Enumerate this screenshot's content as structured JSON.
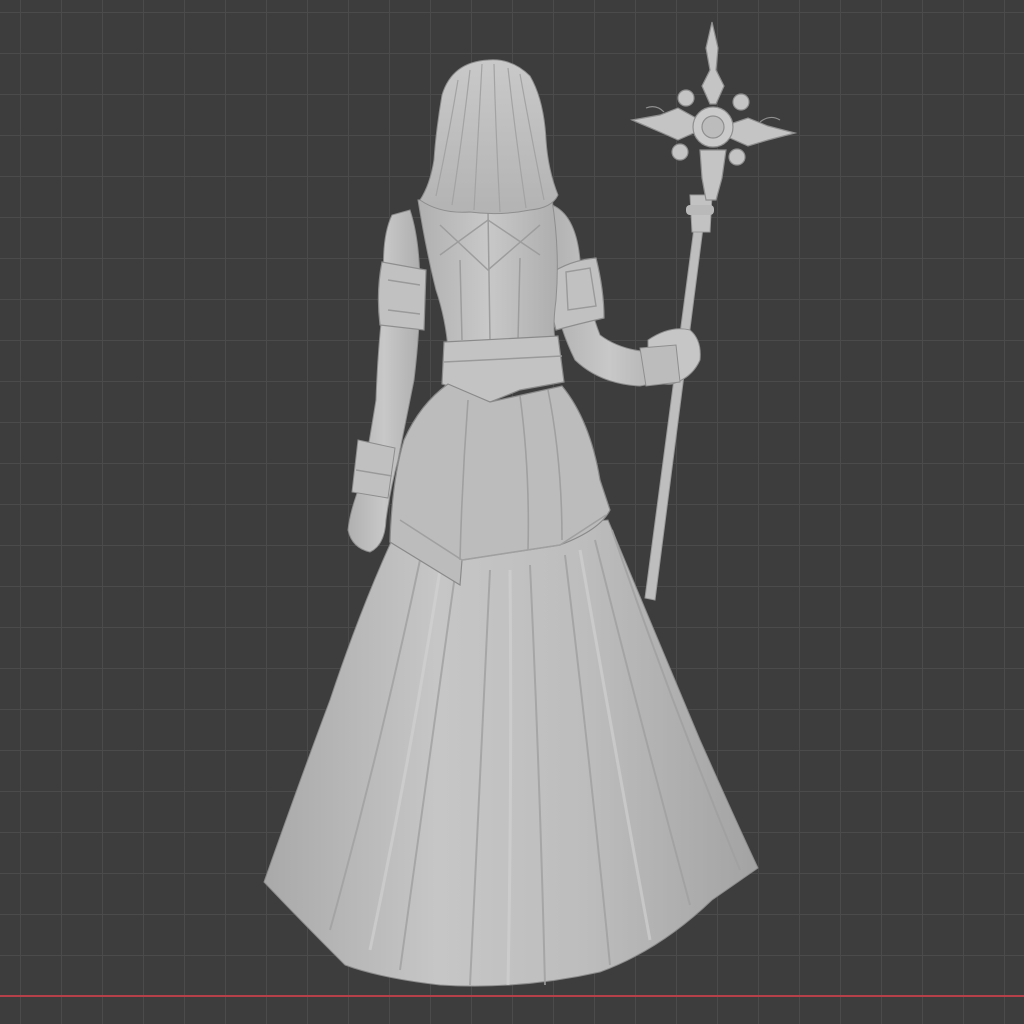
{
  "viewport": {
    "background_color": "#3d3d3d",
    "grid_line_color": "#4b4b4b",
    "x_axis_color": "#b5404a",
    "model_color": "#bdbdbd",
    "model_shadow_color": "#8e8e8e",
    "model_highlight_color": "#d6d6d6"
  },
  "model": {
    "name": "robed-woman-with-staff-sculpt",
    "parts": [
      "hair",
      "shoulders",
      "armbands",
      "sleeves",
      "bodice",
      "belt",
      "overskirt",
      "skirt",
      "staff",
      "cross-head"
    ]
  }
}
